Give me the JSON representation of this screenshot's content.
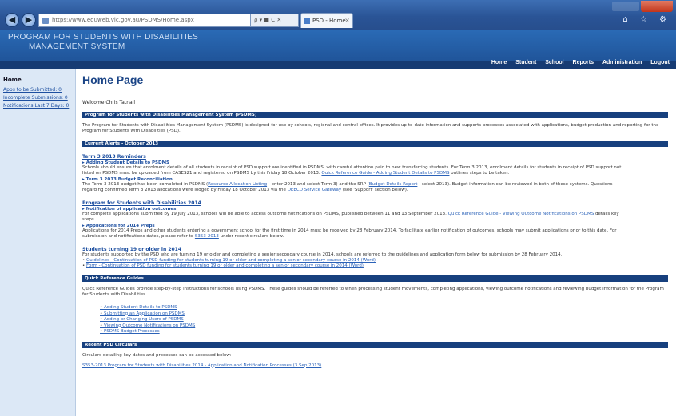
{
  "browser": {
    "url": "https://www.eduweb.vic.gov.au/PSDMS/Home.aspx",
    "url_tools": "ρ ▾ ■ C ✕",
    "tab_title": "PSD - Home",
    "nav_back": "◀",
    "nav_forward": "▶",
    "toolbar_icons": "⌂ ☆ ⚙"
  },
  "site": {
    "title_line1": "Program for Students with Disabilities",
    "title_line2": "Management System"
  },
  "top_nav": [
    "Home",
    "Student",
    "School",
    "Reports",
    "Administration",
    "Logout"
  ],
  "sidebar": {
    "home_label": "Home",
    "links": [
      "Apps to be Submitted: 0",
      "Incomplete Submissions: 0",
      "Notifications Last 7 Days: 0"
    ]
  },
  "main": {
    "title": "Home Page",
    "welcome": "Welcome Chris Tatnall",
    "sections": {
      "about": {
        "heading": "Program for Students with Disabilities Management System (PSDMS)",
        "body": "The Program for Students with Disabilities Management System (PSDMS) is designed for use by schools, regional and central offices. It provides up-to-date information and supports processes associated with applications, budget production and reporting for the Program for Students with Disabilities (PSD)."
      },
      "alerts": {
        "heading": "Current Alerts - October 2013",
        "term3_heading": "Term 3 2013 Reminders",
        "adding_heading": "Adding Student Details to PSDMS",
        "adding_text_1": "Schools should ensure that enrolment details of all students in receipt of PSD support are identified in PSDMS, with careful attention paid to new transferring students. For Term 3 2013, enrolment details for students in receipt of PSD support not",
        "adding_text_2": "listed on PSDMS must be uploaded from CASES21 and registered on PSDMS by this Friday 18 October 2013.",
        "adding_link": "Quick Reference Guide - Adding Student Details to PSDMS",
        "adding_text_3": "outlines steps to be taken.",
        "budget_heading": "Term 3 2013 Budget Reconciliation",
        "budget_text_1": "The Term 3 2013 budget has been completed in PSDMS (",
        "budget_link_1": "Resource Allocation Listing",
        "budget_text_2": "- enter 2013 and select Term 3) and the SRP (",
        "budget_link_2": "Budget Details Report",
        "budget_text_3": "- select 2013). Budget information can be reviewed in both of these systems. Questions",
        "budget_text_4": "regarding confirmed Term 3 2013 allocations were lodged by Friday 18 October 2013 via the",
        "budget_link_3": "DEECD Service Gateway",
        "budget_text_5": "(see 'Support' section below).",
        "psd2014_heading": "Program for Students with Disabilities 2014",
        "notif_heading": "Notification of application outcomes",
        "notif_text_1": "For complete applications submitted by 19 July 2013, schools will be able to access outcome notifications on PSDMS, published between 11 and 13 September 2013.",
        "notif_link": "Quick Reference Guide - Viewing Outcome Notifications on PSDMS",
        "notif_text_2": "details key",
        "notif_text_3": "steps.",
        "prep_heading": "Applications for 2014 Preps",
        "prep_text_1": "Applications for 2014 Preps and other students entering a government school for the first time in 2014 must be received by 28 February 2014. To facilitate earlier notification of outcomes, schools may submit applications prior to this date. For",
        "prep_text_2": "submission and notifications dates, please refer to",
        "prep_link": "S353-2013",
        "prep_text_3": "under recent circulars below.",
        "older_heading": "Students turning 19 or older in 2014",
        "older_text": "For students supported by the PSD who are turning 19 or older and completing a senior secondary course in 2014, schools are referred to the guidelines and application form below for submission by 28 February 2014.",
        "older_links": [
          "Guidelines - Continuation of PSD funding for students turning 19 or older and completing a senior secondary course in 2014 (Word)",
          "Form - Continuation of PSD funding for students turning 19 or older and completing a senior secondary course in 2014 (Word)"
        ]
      },
      "guides": {
        "heading": "Quick Reference Guides",
        "body": "Quick Reference Guides provide step-by-step instructions for schools using PSDMS. These guides should be referred to when processing student movements, completing applications, viewing outcome notifications and reviewing budget information for the Program for Students with Disabilities.",
        "items": [
          "Adding Student Details to PSDMS",
          "Submitting an Application on PSDMS",
          "Adding or Changing Users of PSDMS",
          "Viewing Outcome Notifications on PSDMS",
          "PSDMS Budget Processes"
        ]
      },
      "circulars": {
        "heading": "Recent PSD Circulars",
        "body": "Circulars detailing key dates and processes can be accessed below:",
        "link": "S353-2013 Program for Students with Disabilities 2014 - Application and Notification Processes (3 Sep 2013)"
      }
    }
  }
}
